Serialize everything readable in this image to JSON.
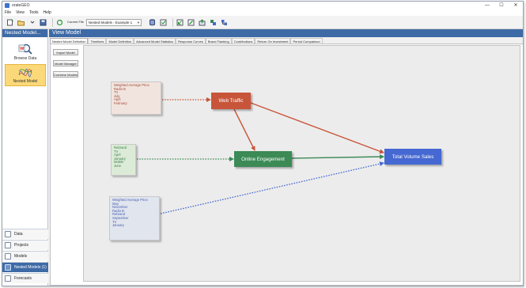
{
  "window": {
    "title": "orateGEO",
    "controls": [
      "—",
      "☐",
      "✕"
    ]
  },
  "menu": [
    "File",
    "View",
    "Tools",
    "Help"
  ],
  "toolbar": {
    "current_file_label": "Current File",
    "file_select_value": "Nested Models - Example 1"
  },
  "left_panel": {
    "header": "Nested Model...",
    "tiles": [
      {
        "label": "Browse Data",
        "icon": "browse-data-icon",
        "active": false
      },
      {
        "label": "Nested Model",
        "icon": "nested-model-icon",
        "active": true
      }
    ],
    "nav": [
      {
        "label": "Data",
        "active": false
      },
      {
        "label": "Projects",
        "active": false
      },
      {
        "label": "Models",
        "active": false
      },
      {
        "label": "Nested Models (1)",
        "active": true
      },
      {
        "label": "Forecasts",
        "active": false
      }
    ]
  },
  "view_header": "View Model",
  "tabs": [
    "Nested Model Definition",
    "Timelines",
    "Model Definition",
    "Advanced Model Statistics",
    "Response Curves",
    "Brand Flanking",
    "Contributions",
    "Return On Investment",
    "Period Comparison"
  ],
  "side_buttons": [
    "Import Model",
    "Model Manager",
    "Combine Models"
  ],
  "diagram": {
    "source_boxes": [
      {
        "lines": [
          "Weighted Average Price",
          "Radio B",
          "TV",
          "July",
          "April",
          "February"
        ]
      },
      {
        "lines": [
          "Rebrand",
          "TV",
          "April",
          "January",
          "Mobile",
          "June"
        ]
      },
      {
        "lines": [
          "Weighted Average Price",
          "May",
          "November",
          "Radio B",
          "Rebrand",
          "September",
          "TV",
          "January"
        ]
      }
    ],
    "nodes": {
      "web_traffic": "Web Traffic",
      "online_engagement": "Online Engagement",
      "total_volume_sales": "Total Volume Sales"
    },
    "colors": {
      "web_traffic": "#c8553a",
      "online_engagement": "#3c8a56",
      "total_volume_sales": "#4568d2",
      "header_blue": "#3e6aa6",
      "active_tile": "#fbd979"
    }
  }
}
